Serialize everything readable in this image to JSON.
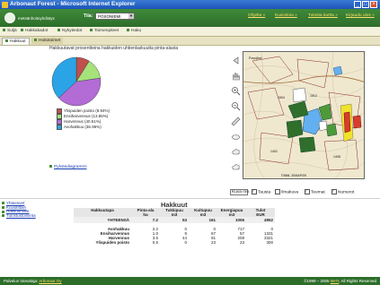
{
  "window": {
    "title": "Arbonaut Forest - Microsoft Internet Explorer"
  },
  "header": {
    "logo_text": "metsänhoitoyhdistys",
    "tila_label": "Tila:",
    "tila_value": "POSONIEMI",
    "links": [
      "Ohjelta »",
      "Kuvioitnia »",
      "Tulosta kartta »",
      "Kirjaudu ulos »"
    ]
  },
  "tabs_main": [
    "Suljä",
    "Hakkakadot",
    "Nykytiedot",
    "Toimenpiteet",
    "Haku"
  ],
  "tabs_sub": [
    "Hakkuut",
    "Hoitotoimet"
  ],
  "chart_title": "Hakkuutavat prosentteina hakkuiden uhtienlaskuutta pinta-alasta",
  "chart_data": {
    "type": "pie",
    "categories": [
      "Ylispuiden poisto (8.94%)",
      "Ensiharvennus (13.85%)",
      "Harvennus (40.51%)",
      "Avohakkuu (36.96%)"
    ],
    "values": [
      8.94,
      13.85,
      40.51,
      36.96
    ],
    "colors": [
      "#c0504d",
      "#a6e27a",
      "#b36bd6",
      "#2aa4e6"
    ]
  },
  "chart_link": "Pylväsdiagrammi",
  "map_labels": [
    "Posojärvi",
    "1504",
    "1512",
    "1402",
    "1408"
  ],
  "map_footer": "©MML 3SMAP/09",
  "map_controls": {
    "zoom_value": "Kuva nro",
    "checkboxes": [
      {
        "label": "Tausta",
        "checked": true
      },
      {
        "label": "Ilmakuva",
        "checked": false
      },
      {
        "label": "Teemat",
        "checked": true
      },
      {
        "label": "Numerot",
        "checked": true
      }
    ]
  },
  "side_links": [
    "Yhteenvet",
    "Kuviotittain",
    "Hakkuumäär",
    "Tulostustoiminta"
  ],
  "hakkuut": {
    "title": "Hakkuut",
    "columns": [
      "Hakkuutapa",
      "Pinta-ala",
      "Tukkipuu",
      "Kuitupuu",
      "Energiapuu",
      "Tulot"
    ],
    "units": [
      "",
      "ha",
      "m3",
      "m3",
      "m3",
      "EUR"
    ],
    "total": [
      "YHTEENSÄ",
      "7.2",
      "53",
      "161",
      "1006",
      "4952"
    ],
    "rows": [
      [
        "Avohakkuu",
        "2.2",
        "0",
        "0",
        "717",
        "0"
      ],
      [
        "Ensiharvennus",
        "1.0",
        "9",
        "67",
        "57",
        "1331"
      ],
      [
        "Harvennus",
        "3.5",
        "44",
        "91",
        "208",
        "3321"
      ],
      [
        "Ylispuiden poisto",
        "0.5",
        "0",
        "23",
        "23",
        "300"
      ]
    ]
  },
  "statusbar": {
    "left_label": "Palvelun toteuttaja:",
    "left_link": "Arbonaut Oy",
    "right_text": "©1999 – 2005",
    "right_link": "MHY",
    "right_tail": "All Rights Reserved"
  }
}
